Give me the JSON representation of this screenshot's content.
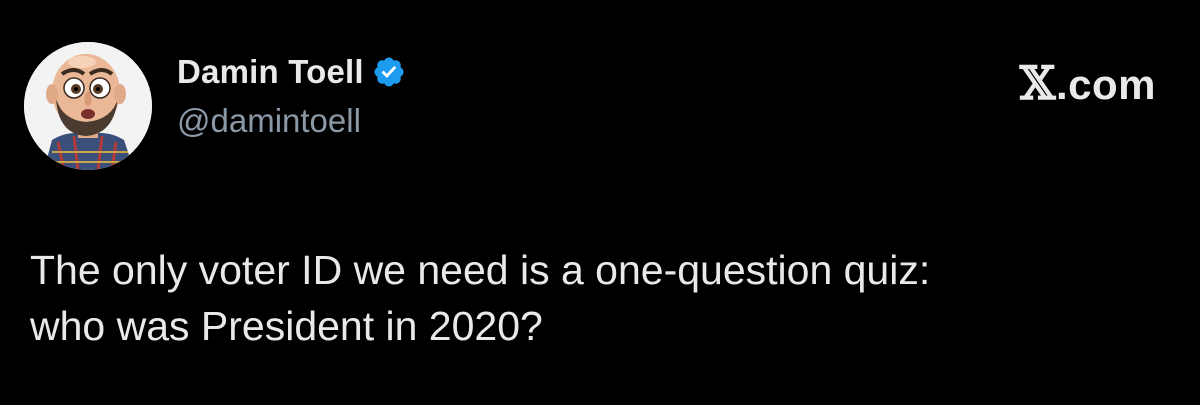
{
  "author": {
    "display_name": "Damin Toell",
    "handle": "@damintoell",
    "verified": true,
    "verified_badge_color": "#1d9bf0",
    "avatar_icon": "caricature-avatar"
  },
  "source": {
    "glyph": "𝕏",
    "domain": ".com"
  },
  "tweet": {
    "line1": "The only voter ID we need is a one-question quiz:",
    "line2": "who was President in 2020?"
  },
  "colors": {
    "background": "#000000",
    "primary_text": "#e7e9ea",
    "secondary_text": "#8b98a5"
  }
}
